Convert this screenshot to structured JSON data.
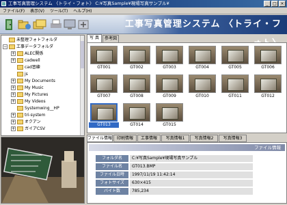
{
  "window": {
    "title": "工事写真管理システム 〈トライ・フォト〉 C:¥写真Sample¥現場写真サンプル¥"
  },
  "menu": [
    "ファイル(F)",
    "表示(V)",
    "ツール(T)",
    "ヘルプ(H)"
  ],
  "banner": "工事写真管理システム 〈トライ・フォト〉",
  "tree": {
    "items": [
      {
        "label": "未整理フォトフォルダ",
        "expander": ""
      },
      {
        "label": "工事データフォルダ",
        "expander": "−"
      },
      {
        "label": "ALEC関係",
        "expander": "+"
      },
      {
        "label": "cadwell",
        "expander": "+"
      },
      {
        "label": "cad習練",
        "expander": ""
      },
      {
        "label": "js",
        "expander": ""
      },
      {
        "label": "My Documents",
        "expander": "+"
      },
      {
        "label": "My Music",
        "expander": "+"
      },
      {
        "label": "My Pictures",
        "expander": "+"
      },
      {
        "label": "My Videos",
        "expander": "+"
      },
      {
        "label": "Systemwing__HP",
        "expander": ""
      },
      {
        "label": "tri-system",
        "expander": "+"
      },
      {
        "label": "オクアン",
        "expander": "+"
      },
      {
        "label": "ガイアCSV",
        "expander": "+"
      }
    ]
  },
  "photo_tabs": [
    "写 真",
    "参考図"
  ],
  "photos": [
    "GT001",
    "GT002",
    "GT003",
    "GT004",
    "GT005",
    "GT006",
    "GT007",
    "GT008",
    "GT009",
    "GT010",
    "GT011",
    "GT012",
    "GT013",
    "GT014",
    "GT015"
  ],
  "selected_photo": "GT013",
  "info_tabs": [
    "ファイル情報",
    "印刷情報",
    "工事情報",
    "写真情報1",
    "写真情報2",
    "写真情報3"
  ],
  "info": {
    "header": "ファイル情報",
    "rows": [
      {
        "key": "フォルダ名",
        "value": "C:¥写真Sample¥現場写真サンプル"
      },
      {
        "key": "ファイル名",
        "value": "GT013.BMP"
      },
      {
        "key": "ファイル日時",
        "value": "1997/11/19 11:42:14"
      },
      {
        "key": "フォトサイズ",
        "value": "630×415"
      },
      {
        "key": "バイト数",
        "value": "785,234"
      }
    ]
  }
}
